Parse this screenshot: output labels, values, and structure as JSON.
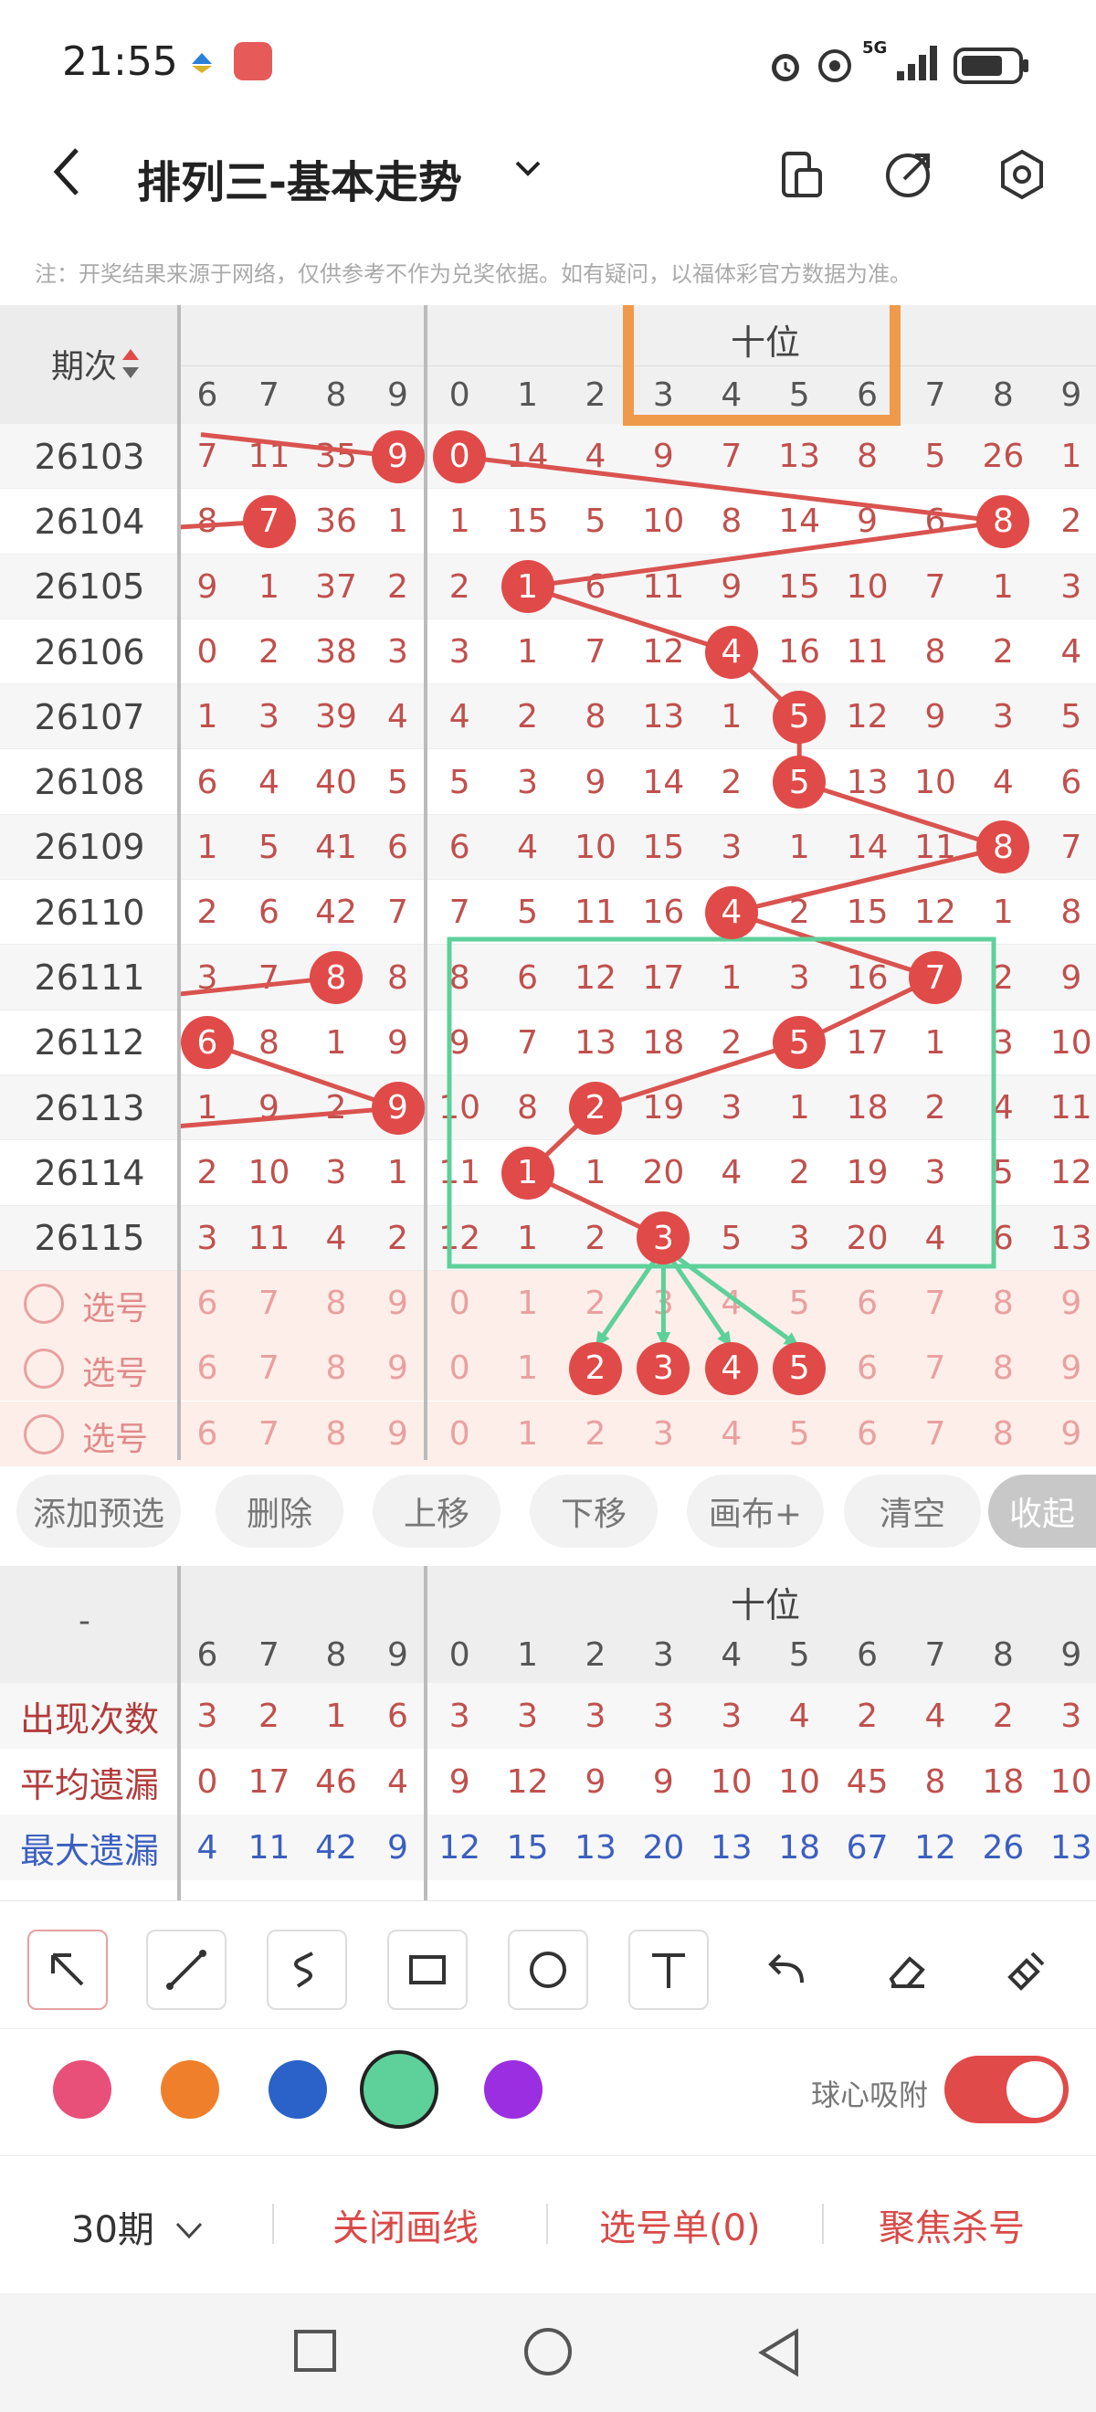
{
  "status_bar": {
    "time": "21:55",
    "network": "5G"
  },
  "header": {
    "title": "排列三-基本走势"
  },
  "notice": "注：开奖结果来源于网络，仅供参考不作为兑奖依据。如有疑问，以福体彩官方数据为准。",
  "table": {
    "period_header": "期次",
    "group_header": "十位",
    "left_cols": [
      "6",
      "7",
      "8",
      "9"
    ],
    "digit_cols": [
      "0",
      "1",
      "2",
      "3",
      "4",
      "5",
      "6",
      "7",
      "8",
      "9"
    ],
    "rows": [
      {
        "period": "26103",
        "left": [
          "7",
          "11",
          "35",
          "9"
        ],
        "right": [
          "0",
          "14",
          "4",
          "9",
          "7",
          "13",
          "8",
          "5",
          "26",
          "1"
        ]
      },
      {
        "period": "26104",
        "left": [
          "8",
          "7",
          "36",
          "1"
        ],
        "right": [
          "1",
          "15",
          "5",
          "10",
          "8",
          "14",
          "9",
          "6",
          "8",
          "2"
        ]
      },
      {
        "period": "26105",
        "left": [
          "9",
          "1",
          "37",
          "2"
        ],
        "right": [
          "2",
          "1",
          "6",
          "11",
          "9",
          "15",
          "10",
          "7",
          "1",
          "3"
        ]
      },
      {
        "period": "26106",
        "left": [
          "0",
          "2",
          "38",
          "3"
        ],
        "right": [
          "3",
          "1",
          "7",
          "12",
          "4",
          "16",
          "11",
          "8",
          "2",
          "4"
        ]
      },
      {
        "period": "26107",
        "left": [
          "1",
          "3",
          "39",
          "4"
        ],
        "right": [
          "4",
          "2",
          "8",
          "13",
          "1",
          "5",
          "12",
          "9",
          "3",
          "5"
        ]
      },
      {
        "period": "26108",
        "left": [
          "6",
          "4",
          "40",
          "5"
        ],
        "right": [
          "5",
          "3",
          "9",
          "14",
          "2",
          "5",
          "13",
          "10",
          "4",
          "6"
        ]
      },
      {
        "period": "26109",
        "left": [
          "1",
          "5",
          "41",
          "6"
        ],
        "right": [
          "6",
          "4",
          "10",
          "15",
          "3",
          "1",
          "14",
          "11",
          "8",
          "7"
        ]
      },
      {
        "period": "26110",
        "left": [
          "2",
          "6",
          "42",
          "7"
        ],
        "right": [
          "7",
          "5",
          "11",
          "16",
          "4",
          "2",
          "15",
          "12",
          "1",
          "8"
        ]
      },
      {
        "period": "26111",
        "left": [
          "3",
          "7",
          "8",
          "8"
        ],
        "right": [
          "8",
          "6",
          "12",
          "17",
          "1",
          "3",
          "16",
          "7",
          "2",
          "9"
        ]
      },
      {
        "period": "26112",
        "left": [
          "6",
          "8",
          "1",
          "9"
        ],
        "right": [
          "9",
          "7",
          "13",
          "18",
          "2",
          "5",
          "17",
          "1",
          "3",
          "10"
        ]
      },
      {
        "period": "26113",
        "left": [
          "1",
          "9",
          "2",
          "9"
        ],
        "right": [
          "10",
          "8",
          "2",
          "19",
          "3",
          "1",
          "18",
          "2",
          "4",
          "11"
        ]
      },
      {
        "period": "26114",
        "left": [
          "2",
          "10",
          "3",
          "1"
        ],
        "right": [
          "11",
          "1",
          "1",
          "20",
          "4",
          "2",
          "19",
          "3",
          "5",
          "12"
        ]
      },
      {
        "period": "26115",
        "left": [
          "3",
          "11",
          "4",
          "2"
        ],
        "right": [
          "12",
          "1",
          "2",
          "3",
          "5",
          "3",
          "20",
          "4",
          "6",
          "13"
        ]
      }
    ],
    "select_label": "选号",
    "select_rows": 3
  },
  "actions": [
    "添加预选",
    "删除",
    "上移",
    "下移",
    "画布+",
    "清空",
    "收起"
  ],
  "stats": {
    "dash": "-",
    "group_header": "十位",
    "rows": [
      {
        "label": "出现次数",
        "left": [
          "3",
          "2",
          "1",
          "6"
        ],
        "right": [
          "3",
          "3",
          "3",
          "3",
          "3",
          "4",
          "2",
          "4",
          "2",
          "3"
        ],
        "color": "red"
      },
      {
        "label": "平均遗漏",
        "left": [
          "0",
          "17",
          "46",
          "4"
        ],
        "right": [
          "9",
          "12",
          "9",
          "9",
          "10",
          "10",
          "45",
          "8",
          "18",
          "10"
        ],
        "color": "red"
      },
      {
        "label": "最大遗漏",
        "left": [
          "4",
          "11",
          "42",
          "9"
        ],
        "right": [
          "12",
          "15",
          "13",
          "20",
          "13",
          "18",
          "67",
          "12",
          "26",
          "13"
        ],
        "color": "blue"
      }
    ]
  },
  "drawing": {
    "tools": [
      "arrow-tool-icon",
      "line-tool-icon",
      "curve-tool-icon",
      "rect-tool-icon",
      "circle-tool-icon",
      "text-tool-icon",
      "undo-icon",
      "eraser-icon",
      "clear-brush-icon"
    ],
    "colors": [
      "#e8507a",
      "#ef7f2a",
      "#2a62c9",
      "#5ed09a",
      "#9b2ee0"
    ],
    "selected_color": "#5ed09a",
    "snap_label": "球心吸附"
  },
  "bottom": {
    "periods": "30期",
    "close_draw": "关闭画线",
    "pick_list": "选号单(0)",
    "focus_kill": "聚焦杀号"
  }
}
